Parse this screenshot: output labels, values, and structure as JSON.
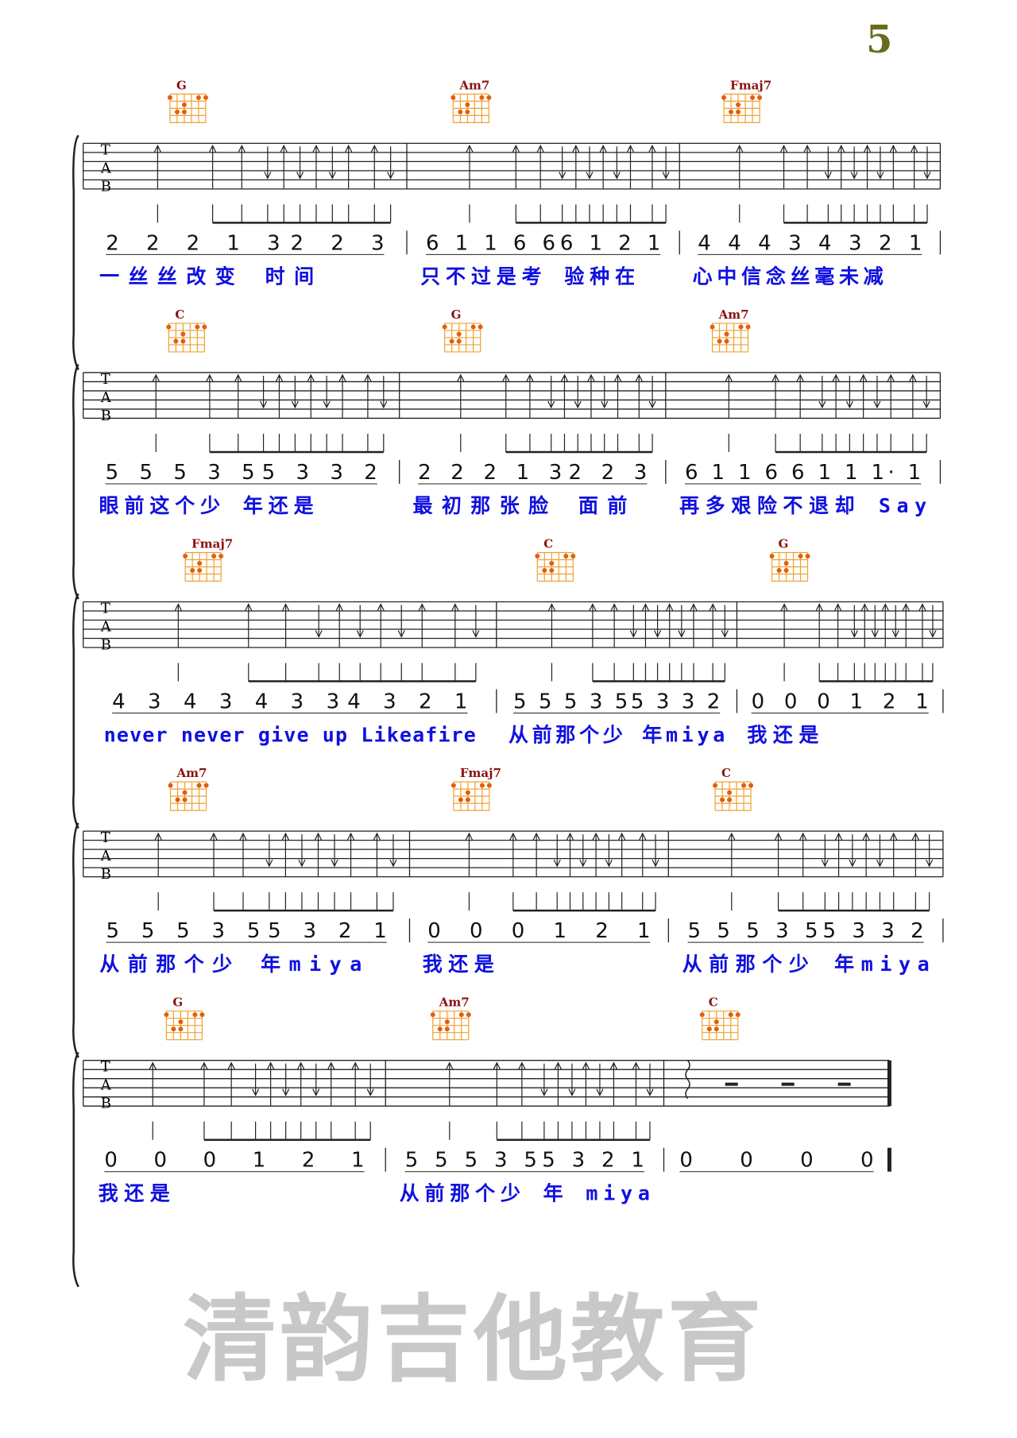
{
  "page_number": "5",
  "watermark": "清韵吉他教育",
  "colors": {
    "lyrics": "#1010e0",
    "chord_name": "#8b1010",
    "chord_grid": "#f0a030",
    "watermark": "#c8c8c8"
  },
  "tab_clef": [
    "T",
    "A",
    "B"
  ],
  "systems": [
    {
      "measures": [
        {
          "chord": "G",
          "numbers": "2 2 2 1 32   2 3",
          "lyrics": "一丝丝改变  时间"
        },
        {
          "chord": "Am7",
          "numbers": "6 1 1 6 66 1 2 1",
          "lyrics": "只不过是考 验种在"
        },
        {
          "chord": "Fmaj7",
          "numbers": "4 4 4 3 4 3 2 1",
          "lyrics": "心中信念丝毫未减"
        }
      ]
    },
    {
      "measures": [
        {
          "chord": "C",
          "numbers": "5 5 5 3 55 3 3 2",
          "lyrics": "眼前这个少 年还是"
        },
        {
          "chord": "G",
          "numbers": "2 2 2 1 32   2 3",
          "lyrics": "最初那张脸  面前"
        },
        {
          "chord": "Am7",
          "numbers": "6 1 1 6 6 1 1 1· 1",
          "lyrics": "再多艰险不退却 Say"
        }
      ]
    },
    {
      "measures": [
        {
          "chord": "Fmaj7",
          "numbers": "4 3 4 3 4 3 34 3 2 1",
          "lyrics": "never never give up Likeafire"
        },
        {
          "chord": "C",
          "numbers": "5 5 5 3 55 3 3 2",
          "lyrics": "从前那个少 年miya"
        },
        {
          "chord": "G",
          "numbers": "0 0 0 1 2 1",
          "lyrics": "我还是"
        }
      ]
    },
    {
      "measures": [
        {
          "chord": "Am7",
          "numbers": "5 5 5 3 55 3 2 1",
          "lyrics": "从前那个少 年miya"
        },
        {
          "chord": "Fmaj7",
          "numbers": "0 0 0 1 2 1",
          "lyrics": "我还是"
        },
        {
          "chord": "C",
          "numbers": "5 5 5 3 55 3 3 2",
          "lyrics": "从前那个少 年miya"
        }
      ]
    },
    {
      "measures": [
        {
          "chord": "G",
          "numbers": "0 0 0 1 2 1",
          "lyrics": "我还是"
        },
        {
          "chord": "Am7",
          "numbers": "5 5 5 3 55 3 2 1",
          "lyrics": "从前那个少 年 miya"
        },
        {
          "chord": "C",
          "numbers": "0 0 0 0",
          "lyrics": ""
        }
      ]
    }
  ]
}
